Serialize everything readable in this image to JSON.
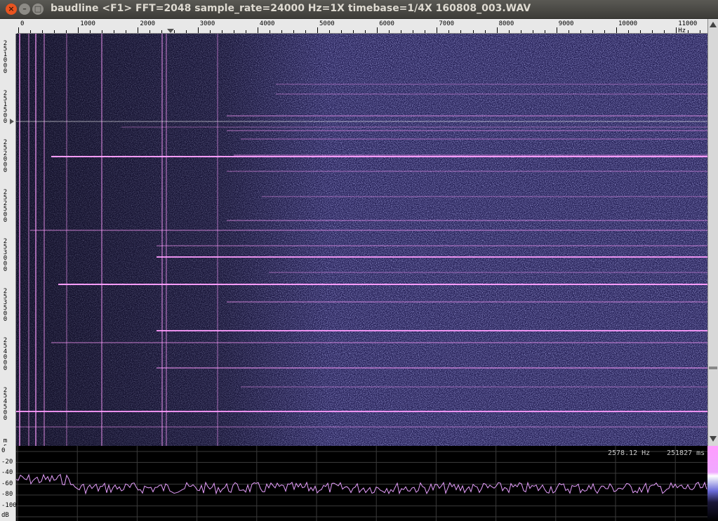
{
  "window": {
    "title": "baudline  <F1> FFT=2048 sample_rate=24000 Hz=1X timebase=1/4X  160808_003.WAV",
    "close_glyph": "×",
    "min_glyph": "–",
    "max_glyph": "□"
  },
  "frequency_axis": {
    "labels": [
      "0",
      "1000",
      "2000",
      "3000",
      "4000",
      "5000",
      "6000",
      "7000",
      "8000",
      "9000",
      "10000",
      "11000 Hz"
    ]
  },
  "time_axis": {
    "labels": [
      "251000",
      "251500",
      "252000",
      "252500",
      "253000",
      "253500",
      "254000",
      "254500"
    ],
    "unit": "ms"
  },
  "db_axis": {
    "labels": [
      "0",
      "-20",
      "-40",
      "-60",
      "-80",
      "-100"
    ],
    "unit": "dB"
  },
  "readout": {
    "frequency": "2578.12 Hz",
    "time": "251827 ms"
  },
  "colors": {
    "background": "#1a1738",
    "signal": "#ff9cff",
    "noise": "#6a6ad8"
  }
}
